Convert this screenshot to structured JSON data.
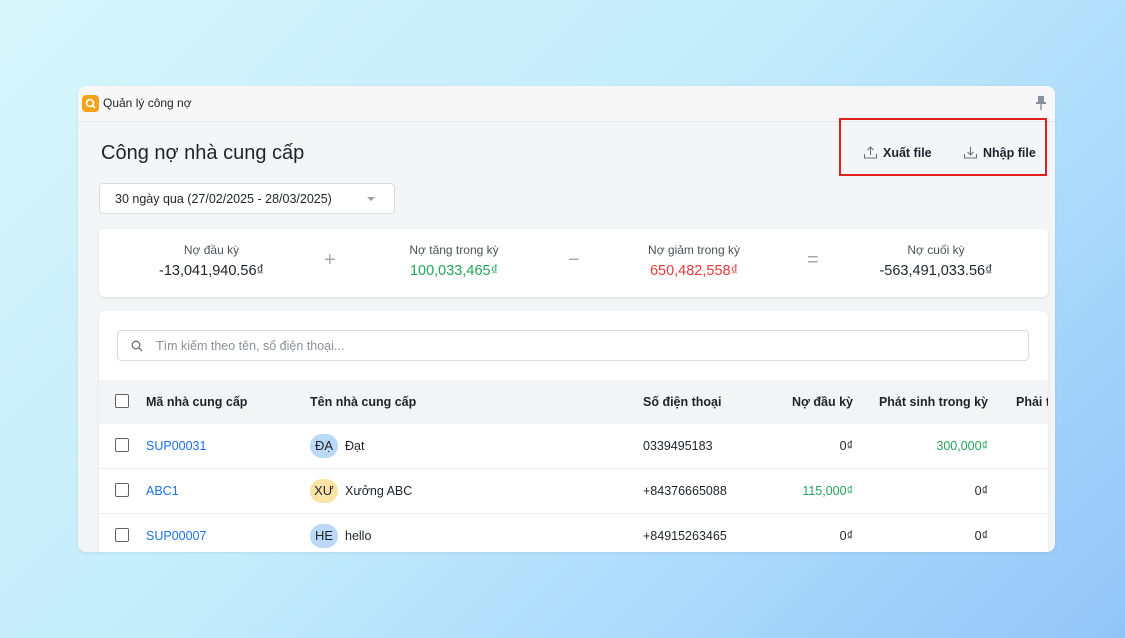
{
  "window": {
    "app_title": "Quản lý công nợ",
    "page_title": "Công nợ nhà cung cấp"
  },
  "actions": {
    "export_label": "Xuất file",
    "import_label": "Nhập file",
    "highlight_color": "#e02020"
  },
  "date_filter": {
    "selected": "30 ngày qua (27/02/2025 - 28/03/2025)"
  },
  "summary": {
    "opening": {
      "label": "Nợ đầu kỳ",
      "value": "-13,041,940.56₫"
    },
    "plus": "+",
    "increase": {
      "label": "Nợ tăng trong kỳ",
      "value": "100,033,465₫"
    },
    "minus": "−",
    "decrease": {
      "label": "Nợ giảm trong kỳ",
      "value": "650,482,558₫"
    },
    "equals": "=",
    "closing": {
      "label": "Nợ cuối kỳ",
      "value": "-563,491,033.56₫"
    }
  },
  "search": {
    "placeholder": "Tìm kiếm theo tên, số điện thoại..."
  },
  "table": {
    "columns": {
      "code": "Mã nhà cung cấp",
      "name": "Tên nhà cung cấp",
      "phone": "Số điện thoại",
      "opening": "Nợ đầu kỳ",
      "incurred": "Phát sinh trong kỳ",
      "payable": "Phải t"
    },
    "rows": [
      {
        "code": "SUP00031",
        "initials": "ĐẠ",
        "avatar_color": "#b9d9f7",
        "name": "Đạt",
        "phone": "0339495183",
        "opening": "0₫",
        "incurred": "300,000₫"
      },
      {
        "code": "ABC1",
        "initials": "XƯ",
        "avatar_color": "#fbe3a6",
        "name": "Xưởng ABC",
        "phone": "+84376665088",
        "opening": "115,000₫",
        "incurred": "0₫"
      },
      {
        "code": "SUP00007",
        "initials": "HE",
        "avatar_color": "#b9d9f7",
        "name": "hello",
        "phone": "+84915263465",
        "opening": "0₫",
        "incurred": "0₫"
      }
    ]
  }
}
